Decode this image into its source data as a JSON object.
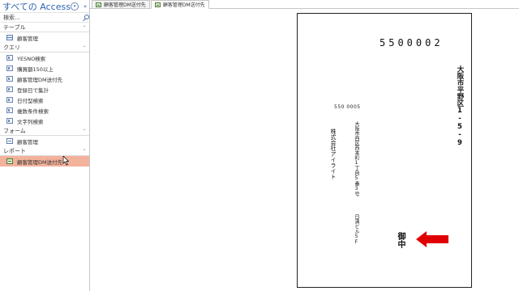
{
  "nav": {
    "title": "すべての Access...",
    "search_placeholder": "検索...",
    "groups": [
      {
        "label": "テーブル",
        "items": [
          {
            "label": "顧客管理",
            "type": "table"
          }
        ]
      },
      {
        "label": "クエリ",
        "items": [
          {
            "label": "YESNO検索",
            "type": "query"
          },
          {
            "label": "購買額150以上",
            "type": "query"
          },
          {
            "label": "顧客管理DM送付先",
            "type": "query"
          },
          {
            "label": "登録日で集計",
            "type": "query"
          },
          {
            "label": "日付型検索",
            "type": "query"
          },
          {
            "label": "複数条件検索",
            "type": "query"
          },
          {
            "label": "文字列検索",
            "type": "query"
          }
        ]
      },
      {
        "label": "フォーム",
        "items": [
          {
            "label": "顧客管理",
            "type": "form"
          }
        ]
      },
      {
        "label": "レポート",
        "items": [
          {
            "label": "顧客管理DM送付先",
            "type": "report",
            "selected": true
          }
        ]
      }
    ]
  },
  "tabs": [
    {
      "label": "顧客管理DM送付先",
      "active": false
    },
    {
      "label": "顧客管理DM送付先",
      "active": true
    }
  ],
  "postcard": {
    "postal_code": "5500002",
    "address1": "大阪市平野区1-5-9",
    "sender_postal": "550 0005",
    "address2": "大阪市西区西本町1丁目5番3号",
    "building": "日清ビル5F",
    "company": "株式会社アイライト",
    "onchu": "御中"
  },
  "colors": {
    "selected_bg": "#f3b29b",
    "arrow": "#e00000",
    "nav_title": "#2c62b2"
  }
}
